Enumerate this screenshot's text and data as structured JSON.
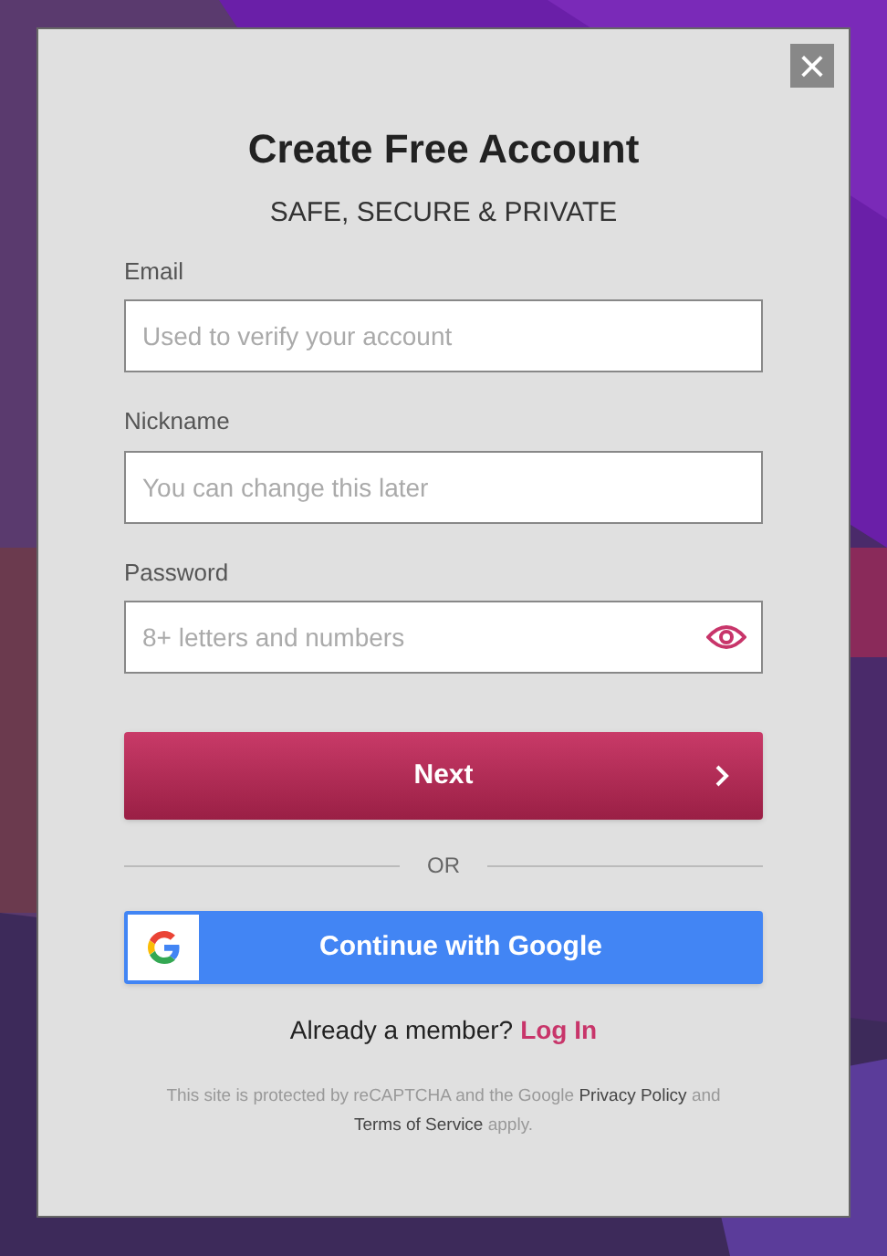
{
  "dialog": {
    "close": "×",
    "title": "Create Free Account",
    "subtitle": "SAFE, SECURE & PRIVATE",
    "fields": [
      {
        "label": "Email",
        "placeholder": "Used to verify your account",
        "kind": "text"
      },
      {
        "label": "Nickname",
        "placeholder": "You can change this later",
        "kind": "text"
      },
      {
        "label": "Password",
        "placeholder": "8+ letters and numbers",
        "kind": "password"
      }
    ],
    "next_button": "Next",
    "divider": "OR",
    "google_button": "Continue with Google",
    "member_text": "Already a member?",
    "login_link": "Log In",
    "legal": {
      "before": "This site is protected by reCAPTCHA and the Google",
      "privacy_link": "Privacy Policy",
      "middle": "and",
      "terms_link": "Terms of Service",
      "after": "apply."
    }
  }
}
